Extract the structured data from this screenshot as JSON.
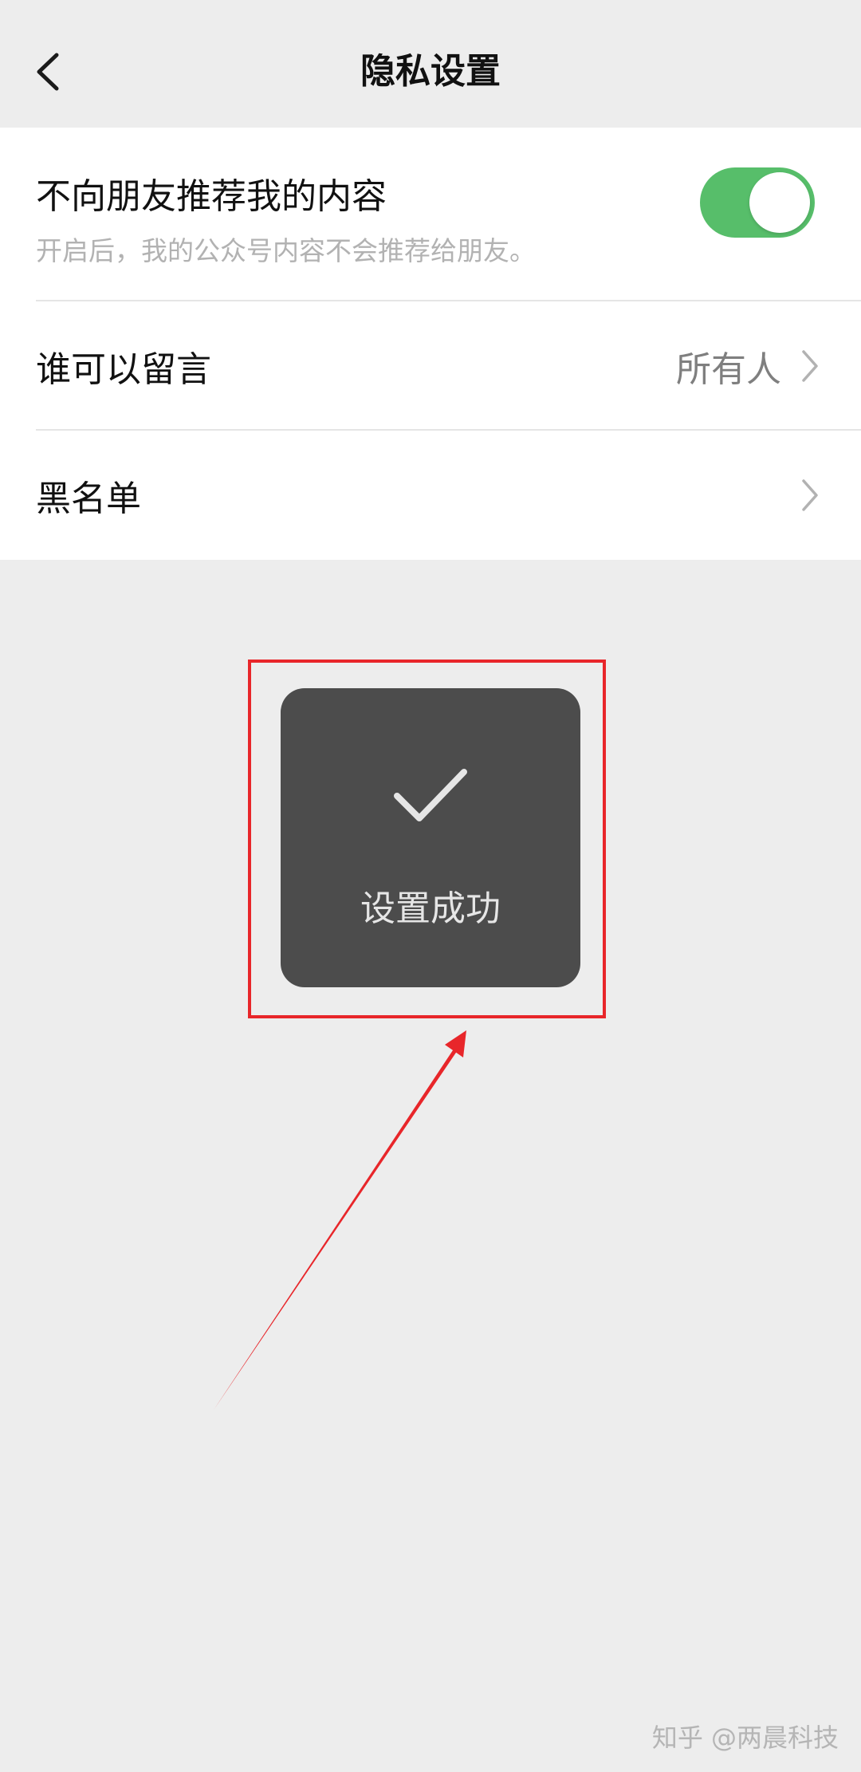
{
  "nav": {
    "title": "隐私设置",
    "back_icon": "chevron-left-icon"
  },
  "settings": {
    "recommend": {
      "title": "不向朋友推荐我的内容",
      "subtitle": "开启后，我的公众号内容不会推荐给朋友。",
      "enabled": true
    },
    "comment": {
      "title": "谁可以留言",
      "value": "所有人"
    },
    "blacklist": {
      "title": "黑名单"
    }
  },
  "toast": {
    "icon": "checkmark-icon",
    "text": "设置成功"
  },
  "watermark": {
    "text": "知乎 @两晨科技"
  },
  "colors": {
    "background": "#ededed",
    "card": "#ffffff",
    "toggle_on": "#57be6a",
    "toast_bg": "#4c4c4c",
    "annotation_red": "#e8262a"
  }
}
